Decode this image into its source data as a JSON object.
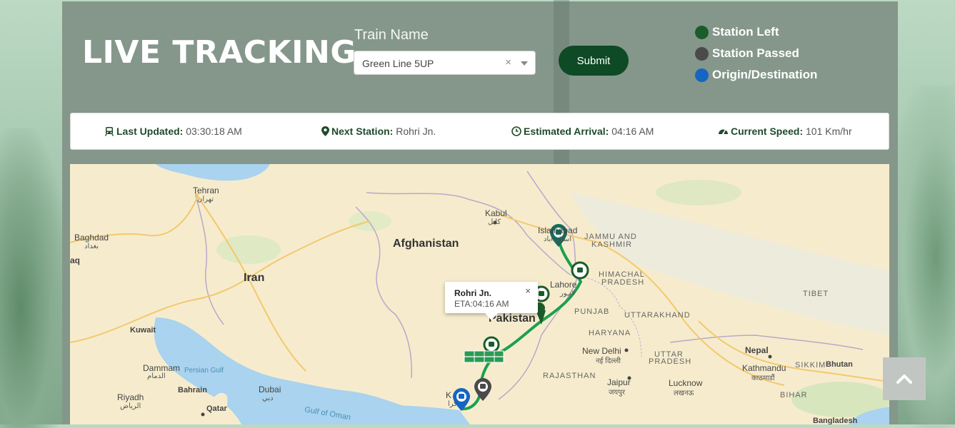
{
  "header": {
    "title": "LIVE TRACKING",
    "train_label": "Train Name",
    "train_select": {
      "value": "Green Line 5UP",
      "clear": "×"
    },
    "submit_label": "Submit"
  },
  "legend": [
    {
      "label": "Station Left",
      "color": "#1a5c2a"
    },
    {
      "label": "Station Passed",
      "color": "#4a4a4a"
    },
    {
      "label": "Origin/Destination",
      "color": "#1566c0"
    }
  ],
  "info": {
    "last_updated": {
      "label": "Last Updated:",
      "value": "03:30:18 AM",
      "icon": "train-icon"
    },
    "next_station": {
      "label": "Next Station:",
      "value": "Rohri Jn.",
      "icon": "map-marker-icon"
    },
    "estimated_arrival": {
      "label": "Estimated Arrival:",
      "value": "04:16 AM",
      "icon": "clock-icon"
    },
    "current_speed": {
      "label": "Current Speed:",
      "value": "101 Km/hr",
      "icon": "speedometer-icon"
    }
  },
  "map": {
    "popup": {
      "title": "Rohri Jn.",
      "eta": "ETA:04:16 AM",
      "close": "×"
    },
    "labels": {
      "tehran": "Tehran",
      "tehran_local": "تهران",
      "baghdad": "Baghdad",
      "baghdad_local": "بغداد",
      "iraq": "aq",
      "iran": "Iran",
      "afghanistan": "Afghanistan",
      "kabul": "Kabul",
      "kabul_local": "کابل",
      "islamabad": "Islamabad",
      "islamabad_local": "اسلام آباد",
      "jammu": "JAMMU AND",
      "kashmir": "KASHMIR",
      "himachal": "HIMACHAL",
      "pradesh": "PRADESH",
      "lahore": "Lahore",
      "lahore_local": "لاہور",
      "punjab": "PUNJAB",
      "tibet": "TIBET",
      "uttarakhand": "UTTARAKHAND",
      "haryana": "HARYANA",
      "pakistan": "Pakistan",
      "kuwait": "Kuwait",
      "new_delhi": "New Delhi",
      "new_delhi_local": "नई दिल्ली",
      "uttar": "UTTAR",
      "uttar_pradesh": "PRADESH",
      "nepal": "Nepal",
      "kathmandu": "Kathmandu",
      "kathmandu_local": "काठमाडौं",
      "sikkim": "SIKKIM",
      "bhutan": "Bhutan",
      "dammam": "Dammam",
      "dammam_local": "الدمام",
      "persian_gulf": "Persian Gulf",
      "bahrain": "Bahrain",
      "dubai": "Dubai",
      "dubai_local": "دبي",
      "rajasthan": "RAJASTHAN",
      "jaipur": "Jaipur",
      "jaipur_local": "जयपुर",
      "lucknow": "Lucknow",
      "lucknow_local": "लखनऊ",
      "bihar": "BIHAR",
      "riyadh": "Riyadh",
      "riyadh_local": "الرياض",
      "qatar": "Qatar",
      "karachi": "K",
      "karachi_local": "کرا",
      "gulf_of_oman": "Gulf of Oman",
      "bangladesh": "Bangladesh"
    }
  },
  "colors": {
    "route": "#1aa050",
    "station_left": "#1a5c2a",
    "station_passed": "#4a4a4a",
    "origin": "#1566c0",
    "panel": "#84978a",
    "submit": "#0d4a25"
  }
}
